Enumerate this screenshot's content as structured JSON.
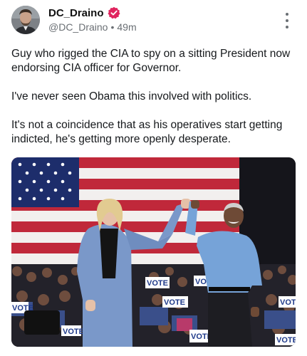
{
  "author": {
    "display_name": "DC_Draino",
    "handle": "@DC_Draino",
    "separator": "•",
    "time": "49m",
    "avatar_icon": "avatar-photo",
    "verified_icon": "verified-badge-icon",
    "verified_color": "#e0245e"
  },
  "post": {
    "paragraphs": [
      "Guy who rigged the CIA to spy on a sitting President now endorsing CIA officer for Governor.",
      "I've never seen Obama this involved with politics.",
      "It's not a coincidence that as his operatives start getting indicted, he's getting more openly desperate."
    ]
  },
  "media": {
    "sign_text": "VOTE"
  },
  "icons": {
    "more": "more-vertical-icon"
  }
}
